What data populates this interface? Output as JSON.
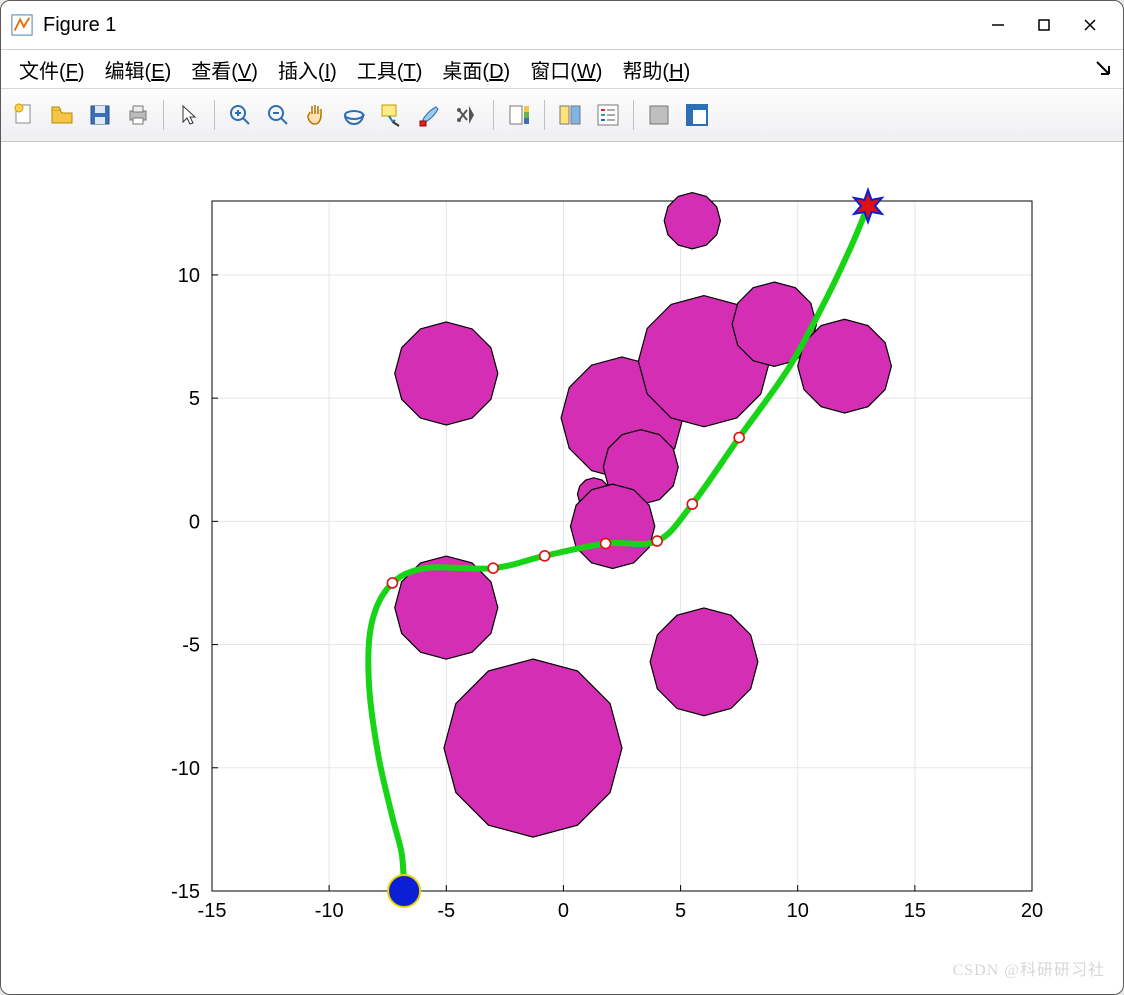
{
  "window": {
    "title": "Figure 1"
  },
  "menu": {
    "file": "文件(F)",
    "edit": "编辑(E)",
    "view": "查看(V)",
    "insert": "插入(I)",
    "tools": "工具(T)",
    "desktop": "桌面(D)",
    "window_menu": "窗口(W)",
    "help": "帮助(H)"
  },
  "watermark": "CSDN @科研研习社",
  "chart_data": {
    "type": "scatter",
    "xlim": [
      -15,
      20
    ],
    "ylim": [
      -15,
      13
    ],
    "xticks": [
      -15,
      -10,
      -5,
      0,
      5,
      10,
      15,
      20
    ],
    "yticks": [
      -15,
      -10,
      -5,
      0,
      5,
      10
    ],
    "grid": true,
    "obstacles": [
      {
        "x": -5,
        "y": 6,
        "r": 2.2
      },
      {
        "x": 2.5,
        "y": 4.2,
        "r": 2.6
      },
      {
        "x": 6,
        "y": 6.5,
        "r": 2.8
      },
      {
        "x": 9,
        "y": 8,
        "r": 1.8
      },
      {
        "x": 12,
        "y": 6.3,
        "r": 2.0
      },
      {
        "x": 5.5,
        "y": 12.2,
        "r": 1.2
      },
      {
        "x": 3.3,
        "y": 2.2,
        "r": 1.6
      },
      {
        "x": 1.3,
        "y": 1.1,
        "r": 0.7
      },
      {
        "x": 2.1,
        "y": -0.2,
        "r": 1.8
      },
      {
        "x": -5,
        "y": -3.5,
        "r": 2.2
      },
      {
        "x": -1.3,
        "y": -9.2,
        "r": 3.8
      },
      {
        "x": 6,
        "y": -5.7,
        "r": 2.3
      }
    ],
    "path_waypoints": [
      {
        "x": -7.3,
        "y": -2.5
      },
      {
        "x": -3.0,
        "y": -1.9
      },
      {
        "x": -0.8,
        "y": -1.4
      },
      {
        "x": 1.8,
        "y": -0.9
      },
      {
        "x": 4.0,
        "y": -0.8
      },
      {
        "x": 5.5,
        "y": 0.7
      },
      {
        "x": 7.5,
        "y": 3.4
      }
    ],
    "path_curve": [
      {
        "x": -6.8,
        "y": -15.0
      },
      {
        "x": -6.9,
        "y": -13.5
      },
      {
        "x": -7.3,
        "y": -12.0
      },
      {
        "x": -7.9,
        "y": -9.5
      },
      {
        "x": -8.3,
        "y": -6.6
      },
      {
        "x": -8.2,
        "y": -4.2
      },
      {
        "x": -7.4,
        "y": -2.6
      },
      {
        "x": -5.9,
        "y": -1.9
      },
      {
        "x": -3.0,
        "y": -1.9
      },
      {
        "x": -0.8,
        "y": -1.4
      },
      {
        "x": 1.8,
        "y": -0.9
      },
      {
        "x": 4.0,
        "y": -0.8
      },
      {
        "x": 5.5,
        "y": 0.7
      },
      {
        "x": 7.5,
        "y": 3.4
      },
      {
        "x": 9.6,
        "y": 6.2
      },
      {
        "x": 11.2,
        "y": 9.0
      },
      {
        "x": 12.3,
        "y": 11.2
      },
      {
        "x": 13.0,
        "y": 12.8
      }
    ],
    "start": {
      "x": -6.8,
      "y": -15.0
    },
    "goal": {
      "x": 13.0,
      "y": 12.8
    }
  }
}
